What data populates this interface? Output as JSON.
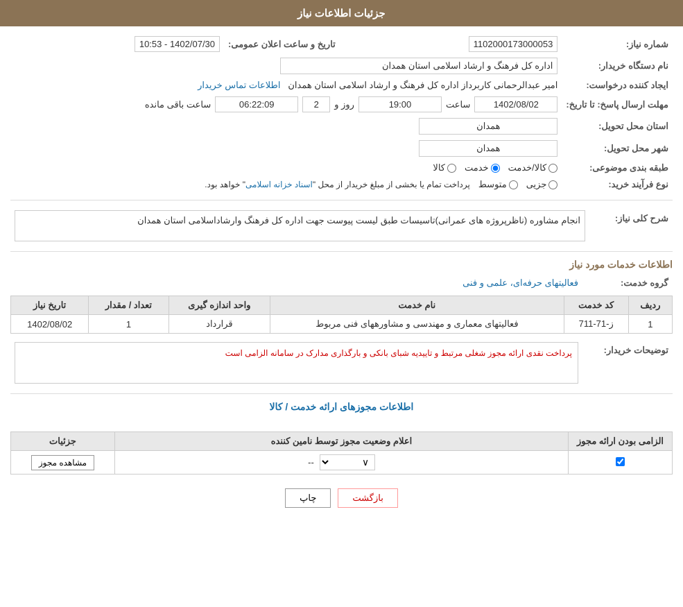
{
  "header": {
    "title": "جزئیات اطلاعات نیاز"
  },
  "fields": {
    "shomara_niaz_label": "شماره نیاز:",
    "shomara_niaz_value": "1102000173000053",
    "nam_dastgah_label": "نام دستگاه خریدار:",
    "nam_dastgah_value": "اداره کل فرهنگ و ارشاد اسلامی استان همدان",
    "ijad_konande_label": "ایجاد کننده درخواست:",
    "ijad_konande_value": "امیر عبدالرحمانی کاربرداز اداره کل فرهنگ و ارشاد اسلامی استان همدان",
    "etelaat_link": "اطلاعات تماس خریدار",
    "mohlat_label": "مهلت ارسال پاسخ: تا تاریخ:",
    "date_value": "1402/08/02",
    "saat_label": "ساعت",
    "saat_value": "19:00",
    "rooz_label": "روز و",
    "rooz_value": "2",
    "remaining_label": "ساعت باقی مانده",
    "remaining_value": "06:22:09",
    "tarikh_aalan_label": "تاریخ و ساعت اعلان عمومی:",
    "tarikh_aalan_value": "1402/07/30 - 10:53",
    "ostan_tahvil_label": "استان محل تحویل:",
    "ostan_tahvil_value": "همدان",
    "shahr_tahvil_label": "شهر محل تحویل:",
    "shahr_tahvil_value": "همدان",
    "tabaqe_label": "طبقه بندی موضوعی:",
    "tabaqe_options": [
      "کالا",
      "خدمت",
      "کالا/خدمت"
    ],
    "tabaqe_selected": "خدمت",
    "nooe_farayand_label": "نوع فرآیند خرید:",
    "nooe_farayand_options": [
      "جزیی",
      "متوسط"
    ],
    "nooe_farayand_note": "پرداخت تمام یا بخشی از مبلغ خریدار از محل \"اسناد خزانه اسلامی\" خواهد بود.",
    "sharh_label": "شرح کلی نیاز:",
    "sharh_value": "انجام مشاوره  (ناظرپروژه های عمرانی)تاسیسات طبق لیست پیوست جهت اداره کل فرهنگ وارشاداسلامی استان همدان",
    "services_section_title": "اطلاعات خدمات مورد نیاز",
    "grooh_khadamat_label": "گروه خدمت:",
    "grooh_khadamat_value": "فعالیتهای حرفه‌ای، علمی و فنی",
    "table_headers": {
      "radif": "ردیف",
      "code_khadamat": "کد خدمت",
      "name_khadamat": "نام خدمت",
      "vahed": "واحد اندازه گیری",
      "tedad": "تعداد / مقدار",
      "tarikh_niaz": "تاریخ نیاز"
    },
    "table_rows": [
      {
        "radif": "1",
        "code_khadamat": "ز-71-711",
        "name_khadamat": "فعالیتهای معماری و مهندسی و مشاورههای فنی مربوط",
        "vahed": "قرارداد",
        "tedad": "1",
        "tarikh_niaz": "1402/08/02"
      }
    ],
    "buyer_note_label": "توضیحات خریدار:",
    "buyer_note_value": "پرداخت نقدی ارائه مجوز شغلی مرتبط و تاییدیه شبای بانکی و بارگذاری مدارک در سامانه الزامی است",
    "licenses_section_title": "اطلاعات مجوزهای ارائه خدمت / کالا",
    "license_table_headers": {
      "elzami": "الزامی بودن ارائه مجوز",
      "alam": "اعلام وضعیت مجوز توسط نامین کننده",
      "joziat": "جزئیات"
    },
    "license_rows": [
      {
        "elzami": true,
        "alam_value": "--",
        "joziat_btn": "مشاهده مجوز"
      }
    ],
    "btn_print": "چاپ",
    "btn_back": "بازگشت"
  }
}
